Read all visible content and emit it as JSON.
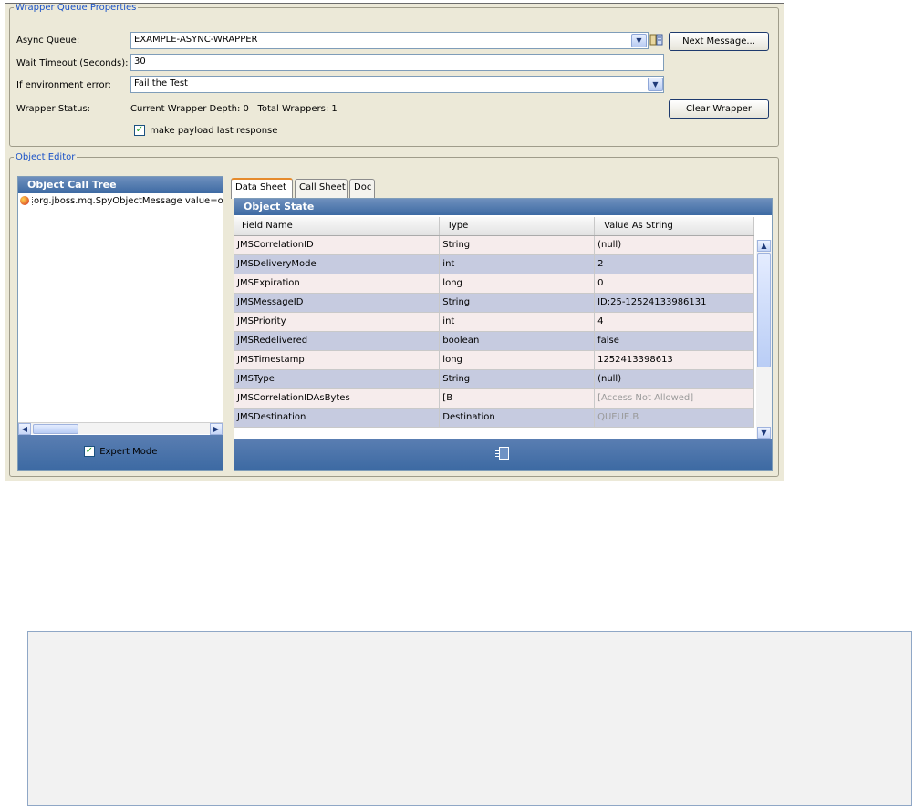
{
  "wrapper": {
    "legend": "Wrapper Queue Properties",
    "async_queue_label": "Async Queue:",
    "async_queue_value": "EXAMPLE-ASYNC-WRAPPER",
    "next_message_label": "Next Message...",
    "wait_timeout_label": "Wait Timeout (Seconds):",
    "wait_timeout_value": "30",
    "env_error_label": "If environment error:",
    "env_error_value": "Fail the Test",
    "status_label": "Wrapper Status:",
    "status_value": "Current Wrapper Depth: 0   Total Wrappers: 1",
    "clear_wrapper_label": "Clear Wrapper",
    "payload_checkbox_label": "make payload last response",
    "payload_checked": true
  },
  "object_editor": {
    "legend": "Object Editor",
    "tree": {
      "title": "Object Call Tree",
      "item": "org.jboss.mq.SpyObjectMessage value=o",
      "expert_mode_label": "Expert Mode",
      "expert_checked": true
    },
    "tabs": [
      {
        "label": "Data Sheet",
        "active": true
      },
      {
        "label": "Call Sheet",
        "active": false
      },
      {
        "label": "Doc",
        "active": false
      }
    ],
    "state": {
      "title": "Object State",
      "columns": [
        "Field Name",
        "Type",
        "Value As String"
      ],
      "rows": [
        {
          "field": "JMSCorrelationID",
          "type": "String",
          "value": "(null)",
          "muted": false
        },
        {
          "field": "JMSDeliveryMode",
          "type": "int",
          "value": "2",
          "muted": false
        },
        {
          "field": "JMSExpiration",
          "type": "long",
          "value": "0",
          "muted": false
        },
        {
          "field": "JMSMessageID",
          "type": "String",
          "value": "ID:25-12524133986131",
          "muted": false
        },
        {
          "field": "JMSPriority",
          "type": "int",
          "value": "4",
          "muted": false
        },
        {
          "field": "JMSRedelivered",
          "type": "boolean",
          "value": "false",
          "muted": false
        },
        {
          "field": "JMSTimestamp",
          "type": "long",
          "value": "1252413398613",
          "muted": false
        },
        {
          "field": "JMSType",
          "type": "String",
          "value": "(null)",
          "muted": false
        },
        {
          "field": "JMSCorrelationIDAsBytes",
          "type": "[B",
          "value": "[Access Not Allowed]",
          "muted": true
        },
        {
          "field": "JMSDestination",
          "type": "Destination",
          "value": "QUEUE.B",
          "muted": true
        }
      ]
    }
  },
  "colors": {
    "legend_blue": "#1a52c8",
    "panel_header": "#3d6aa3",
    "row_odd": "#f6ecec",
    "row_even": "#c6cbe0",
    "active_tab_accent": "#e68b2c"
  }
}
